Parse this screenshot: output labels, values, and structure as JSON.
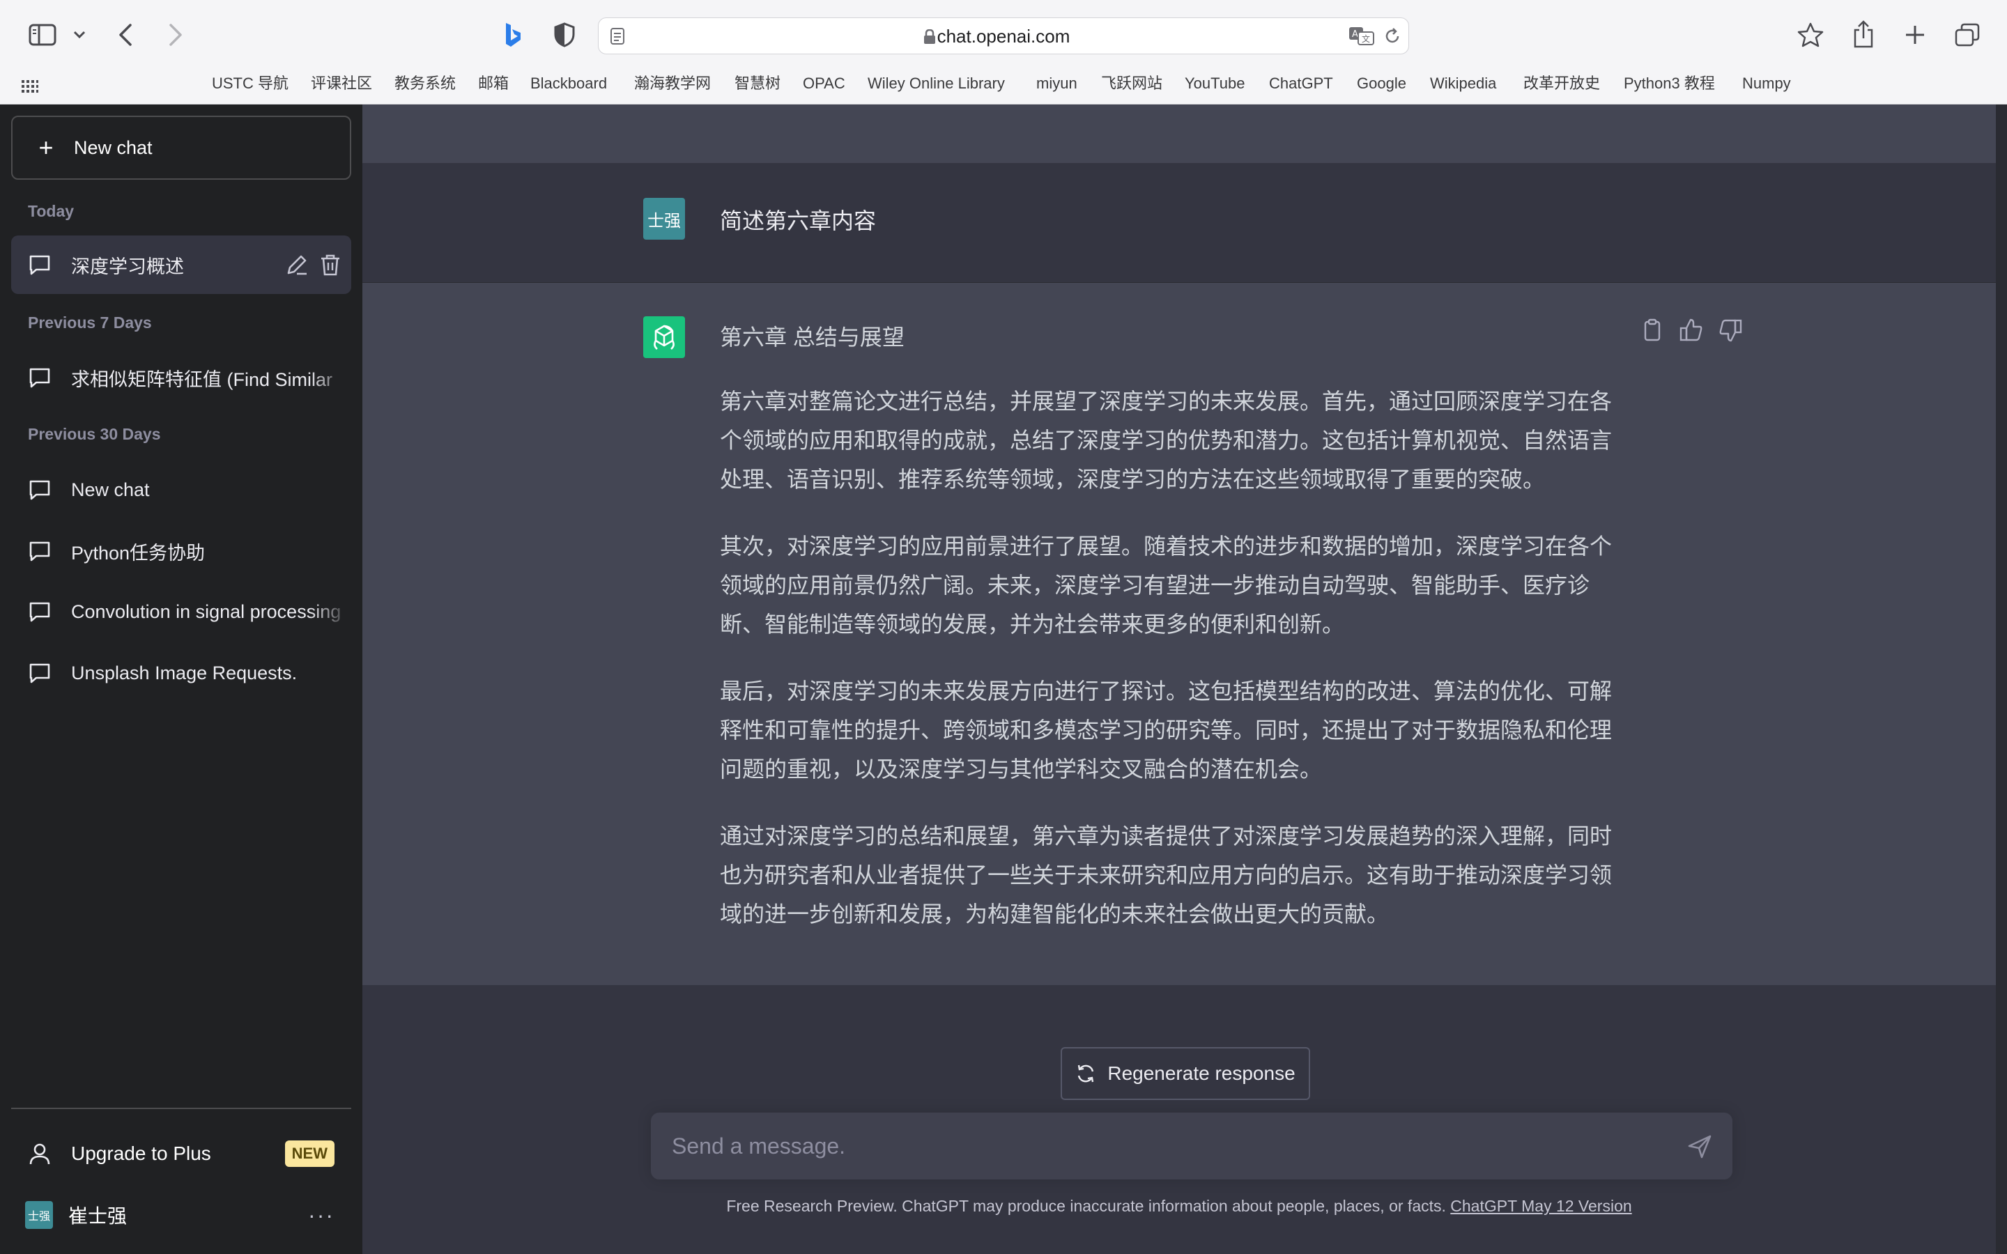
{
  "browser": {
    "url": "chat.openai.com",
    "icons": [
      "sidebar-toggle-icon",
      "chevron-down-icon",
      "back-icon",
      "forward-icon",
      "bing-icon",
      "privacy-shield-icon",
      "page-icon",
      "lock-icon",
      "translate-icon",
      "reload-icon",
      "star-icon",
      "share-icon",
      "new-tab-icon",
      "tabs-overview-icon",
      "grid-icon"
    ],
    "bookmarks": [
      "USTC 导航",
      "评课社区",
      "教务系统",
      "邮箱",
      "Blackboard",
      "瀚海教学网",
      "智慧树",
      "OPAC",
      "Wiley Online Library",
      "miyun",
      "飞跃网站",
      "YouTube",
      "ChatGPT",
      "Google",
      "Wikipedia",
      "改革开放史",
      "Python3 教程",
      "Numpy"
    ]
  },
  "sidebar": {
    "new_chat": "New chat",
    "sections": {
      "today": "Today",
      "prev7": "Previous 7 Days",
      "prev30": "Previous 30 Days"
    },
    "today_items": [
      "深度学习概述"
    ],
    "prev7_items": [
      "求相似矩阵特征值 (Find Similar"
    ],
    "prev30_items": [
      "New chat",
      "Python任务协助",
      "Convolution in signal processing",
      "Unsplash Image Requests."
    ],
    "upgrade": "Upgrade to Plus",
    "new_badge": "NEW",
    "user_name": "崔士强",
    "user_avatar_text": "士强",
    "more": "···"
  },
  "chat": {
    "user_avatar_text": "士强",
    "user_message": "简述第六章内容",
    "assistant_title": "第六章 总结与展望",
    "assistant_paragraphs": [
      "第六章对整篇论文进行总结，并展望了深度学习的未来发展。首先，通过回顾深度学习在各个领域的应用和取得的成就，总结了深度学习的优势和潜力。这包括计算机视觉、自然语言处理、语音识别、推荐系统等领域，深度学习的方法在这些领域取得了重要的突破。",
      "其次，对深度学习的应用前景进行了展望。随着技术的进步和数据的增加，深度学习在各个领域的应用前景仍然广阔。未来，深度学习有望进一步推动自动驾驶、智能助手、医疗诊断、智能制造等领域的发展，并为社会带来更多的便利和创新。",
      "最后，对深度学习的未来发展方向进行了探讨。这包括模型结构的改进、算法的优化、可解释性和可靠性的提升、跨领域和多模态学习的研究等。同时，还提出了对于数据隐私和伦理问题的重视，以及深度学习与其他学科交叉融合的潜在机会。",
      "通过对深度学习的总结和展望，第六章为读者提供了对深度学习发展趋势的深入理解，同时也为研究者和从业者提供了一些关于未来研究和应用方向的启示。这有助于推动深度学习领域的进一步创新和发展，为构建智能化的未来社会做出更大的贡献。"
    ],
    "regenerate": "Regenerate response",
    "input_placeholder": "Send a message.",
    "footer_text": "Free Research Preview. ChatGPT may produce inaccurate information about people, places, or facts. ",
    "footer_link": "ChatGPT May 12 Version"
  },
  "colors": {
    "sidebar_bg": "#202123",
    "main_bg": "#343541",
    "assistant_bg": "#444654",
    "gpt_green": "#19c37d",
    "user_avatar": "#3d8c95",
    "badge": "#fae69e"
  }
}
